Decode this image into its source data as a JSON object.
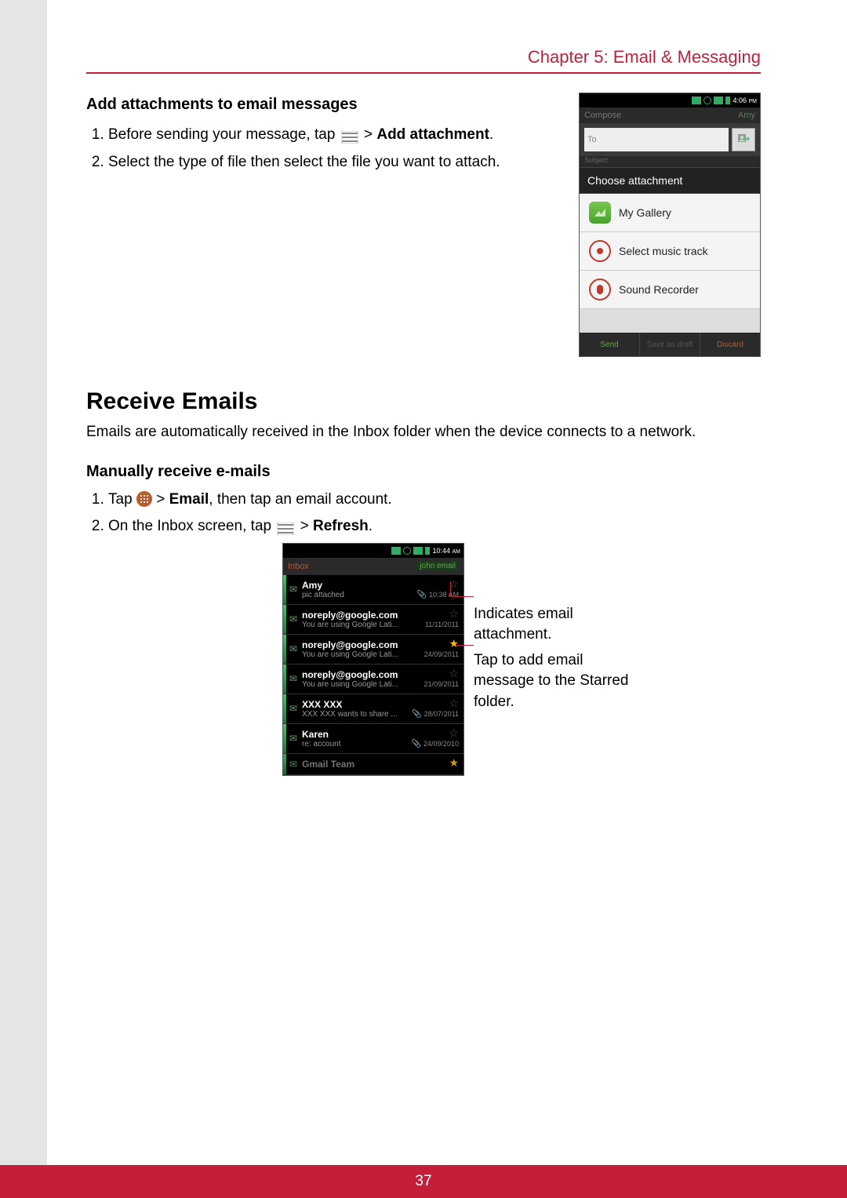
{
  "chapter": "Chapter 5: Email & Messaging",
  "pageNumber": "37",
  "section1": {
    "title": "Add attachments to email messages",
    "steps": {
      "s1a": "Before sending your message, tap ",
      "s1b": " > ",
      "s1c": "Add attachment",
      "s1d": ".",
      "s2": "Select the type of file then select the file you want to attach."
    }
  },
  "phone1": {
    "time": "4:06 ",
    "ampm": "PM",
    "composeLabel": "Compose",
    "account": "Amy",
    "toPlaceholder": "To",
    "subjectLabel": "Subject",
    "chooseHeader": "Choose attachment",
    "items": {
      "gallery": "My Gallery",
      "music": "Select music track",
      "recorder": "Sound Recorder"
    },
    "buttons": {
      "send": "Send",
      "save": "Save as draft",
      "discard": "Discard"
    }
  },
  "section2": {
    "heading": "Receive Emails",
    "intro": "Emails are automatically received in the Inbox folder when the device connects to a network.",
    "subheading": "Manually receive e-mails",
    "steps": {
      "s1a": "Tap ",
      "s1b": " > ",
      "s1c": "Email",
      "s1d": ", then tap an email account.",
      "s2a": "On the Inbox screen, tap ",
      "s2b": " > ",
      "s2c": "Refresh",
      "s2d": "."
    }
  },
  "phone2": {
    "time": "10:44 ",
    "ampm": "AM",
    "inboxLabel": "Inbox",
    "account": "john email",
    "rows": [
      {
        "sender": "Amy",
        "subject": "pic attached",
        "date": "10:38 AM",
        "clip": true,
        "starred": false
      },
      {
        "sender": "noreply@google.com",
        "subject": "You are using Google Lati...",
        "date": "11/11/2011",
        "clip": false,
        "starred": false
      },
      {
        "sender": "noreply@google.com",
        "subject": "You are using Google Lati...",
        "date": "24/09/2011",
        "clip": false,
        "starred": true
      },
      {
        "sender": "noreply@google.com",
        "subject": "You are using Google Lati...",
        "date": "21/09/2011",
        "clip": false,
        "starred": false
      },
      {
        "sender": "XXX XXX",
        "subject": "XXX XXX wants to share ...",
        "date": "28/07/2011",
        "clip": true,
        "starred": false
      },
      {
        "sender": "Karen",
        "subject": "re: account",
        "date": "24/09/2010",
        "clip": true,
        "starred": false
      },
      {
        "sender": "Gmail Team",
        "subject": "",
        "date": "",
        "clip": false,
        "starred": true
      }
    ]
  },
  "annotations": {
    "a1": "Indicates email attachment.",
    "a2": "Tap to add email message to the Starred folder."
  }
}
